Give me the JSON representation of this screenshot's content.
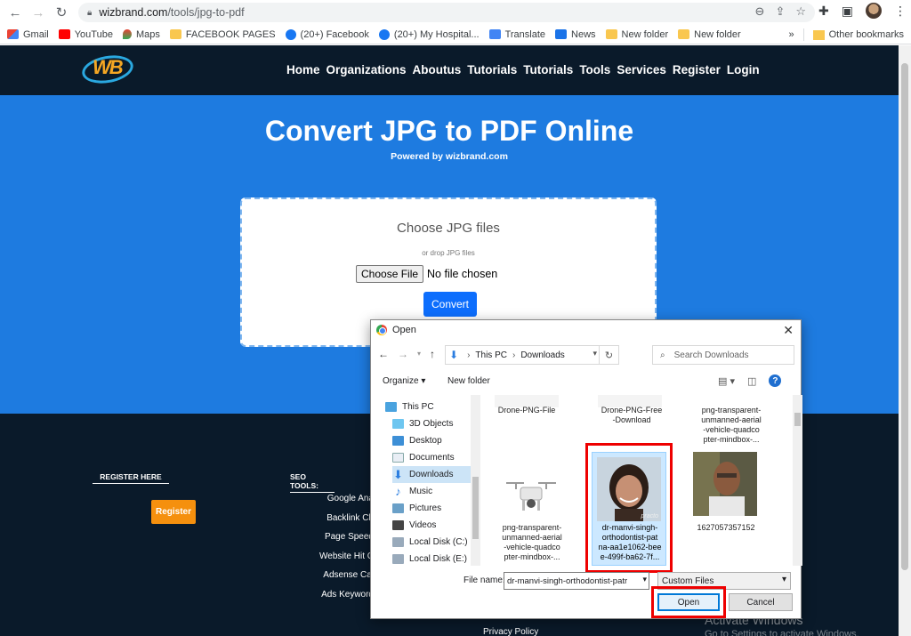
{
  "browser": {
    "url_host": "wizbrand.com",
    "url_path": "/tools/jpg-to-pdf",
    "bookmarks": [
      {
        "label": "Gmail",
        "icon": "gmail-icon"
      },
      {
        "label": "YouTube",
        "icon": "youtube-icon"
      },
      {
        "label": "Maps",
        "icon": "maps-icon"
      },
      {
        "label": "FACEBOOK PAGES",
        "icon": "folder-icon"
      },
      {
        "label": "(20+) Facebook",
        "icon": "facebook-icon"
      },
      {
        "label": "(20+) My Hospital...",
        "icon": "facebook-icon"
      },
      {
        "label": "Translate",
        "icon": "translate-icon"
      },
      {
        "label": "News",
        "icon": "news-icon"
      },
      {
        "label": "New folder",
        "icon": "folder-icon"
      },
      {
        "label": "New folder",
        "icon": "folder-icon"
      }
    ],
    "bookmarks_overflow": "»",
    "other_bookmarks": "Other bookmarks"
  },
  "site": {
    "logo_text": "WB",
    "nav": [
      "Home",
      "Organizations",
      "Aboutus",
      "Tutorials",
      "Tutorials",
      "Tools",
      "Services",
      "Register",
      "Login"
    ],
    "hero_title": "Convert JPG to PDF Online",
    "hero_subtitle": "Powered by wizbrand.com",
    "upload_title": "Choose JPG files",
    "upload_hint": "or drop JPG files",
    "choose_file_label": "Choose File",
    "no_file_label": "No file chosen",
    "convert_label": "Convert",
    "footer_register_head": "REGISTER HERE",
    "footer_register_btn": "Register",
    "footer_seo_head": "SEO TOOLS:",
    "footer_seo_links": [
      "Google Ana",
      "Backlink Ch",
      "Page Speed",
      "Website Hit C",
      "Adsense Cal",
      "Ads Keyword"
    ],
    "footer_privacy": "Privacy Policy",
    "watermark_line1": "Activate Windows",
    "watermark_line2": "Go to Settings to activate Windows."
  },
  "dialog": {
    "title": "Open",
    "breadcrumb_root": "This PC",
    "breadcrumb_current": "Downloads",
    "search_placeholder": "Search Downloads",
    "organize_label": "Organize ▾",
    "new_folder_label": "New folder",
    "nav_items": [
      {
        "label": "This PC",
        "icon": "pc-icon"
      },
      {
        "label": "3D Objects",
        "icon": "3d-objects-icon"
      },
      {
        "label": "Desktop",
        "icon": "desktop-icon"
      },
      {
        "label": "Documents",
        "icon": "documents-icon"
      },
      {
        "label": "Downloads",
        "icon": "downloads-icon",
        "selected": true
      },
      {
        "label": "Music",
        "icon": "music-icon"
      },
      {
        "label": "Pictures",
        "icon": "pictures-icon"
      },
      {
        "label": "Videos",
        "icon": "videos-icon"
      },
      {
        "label": "Local Disk (C:)",
        "icon": "disk-icon"
      },
      {
        "label": "Local Disk (E:)",
        "icon": "disk-icon"
      }
    ],
    "files": [
      {
        "label": "Drone-PNG-File"
      },
      {
        "label": "Drone-PNG-Free\n-Download"
      },
      {
        "label": "png-transparent-\nunmanned-aerial\n-vehicle-quadco\npter-mindbox-..."
      },
      {
        "label": "png-transparent-\nunmanned-aerial\n-vehicle-quadco\npter-mindbox-..."
      },
      {
        "label": "dr-manvi-singh-\northodontist-pat\nna-aa1e1062-bee\ne-499f-ba62-7f...",
        "selected": true
      },
      {
        "label": "1627057357152"
      }
    ],
    "thumb_watermark": "practo",
    "filename_label": "File name:",
    "filename_value": "dr-manvi-singh-orthodontist-patr",
    "filetype_value": "Custom Files",
    "open_label": "Open",
    "cancel_label": "Cancel"
  }
}
